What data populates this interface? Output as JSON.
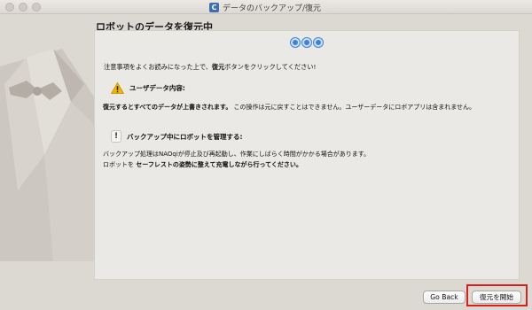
{
  "window": {
    "title": "データのバックアップ/復元",
    "app_icon_letter": "C"
  },
  "heading": "ロボットのデータを復元中",
  "intro": {
    "before": "注意事項をよくお読みになった上で、",
    "bold": "復元",
    "after": "ボタンをクリックしてください!"
  },
  "section1": {
    "title": "ユーザデータ内容:",
    "bold": "復元するとすべてのデータが上書きされます。",
    "rest": " この操作は元に戻すことはできません。ユーザーデータにロボアプリは含まれません。"
  },
  "section2": {
    "title": "バックアップ中にロボットを管理する:",
    "line1": "バックアップ処理はNAOqiが停止及び再起動し、作業にしばらく時間がかかる場合があります。",
    "line2_prefix": "ロボットを ",
    "line2_bold": "セーフレストの姿勢に整えて充電しながら行ってください。"
  },
  "buttons": {
    "back": "Go Back",
    "start": "復元を開始"
  },
  "colors": {
    "accent": "#3b82d8",
    "highlight": "#e01d1d",
    "warning": "#f2b600"
  },
  "icons": {
    "warning": "warning-icon",
    "info": "info-icon"
  }
}
